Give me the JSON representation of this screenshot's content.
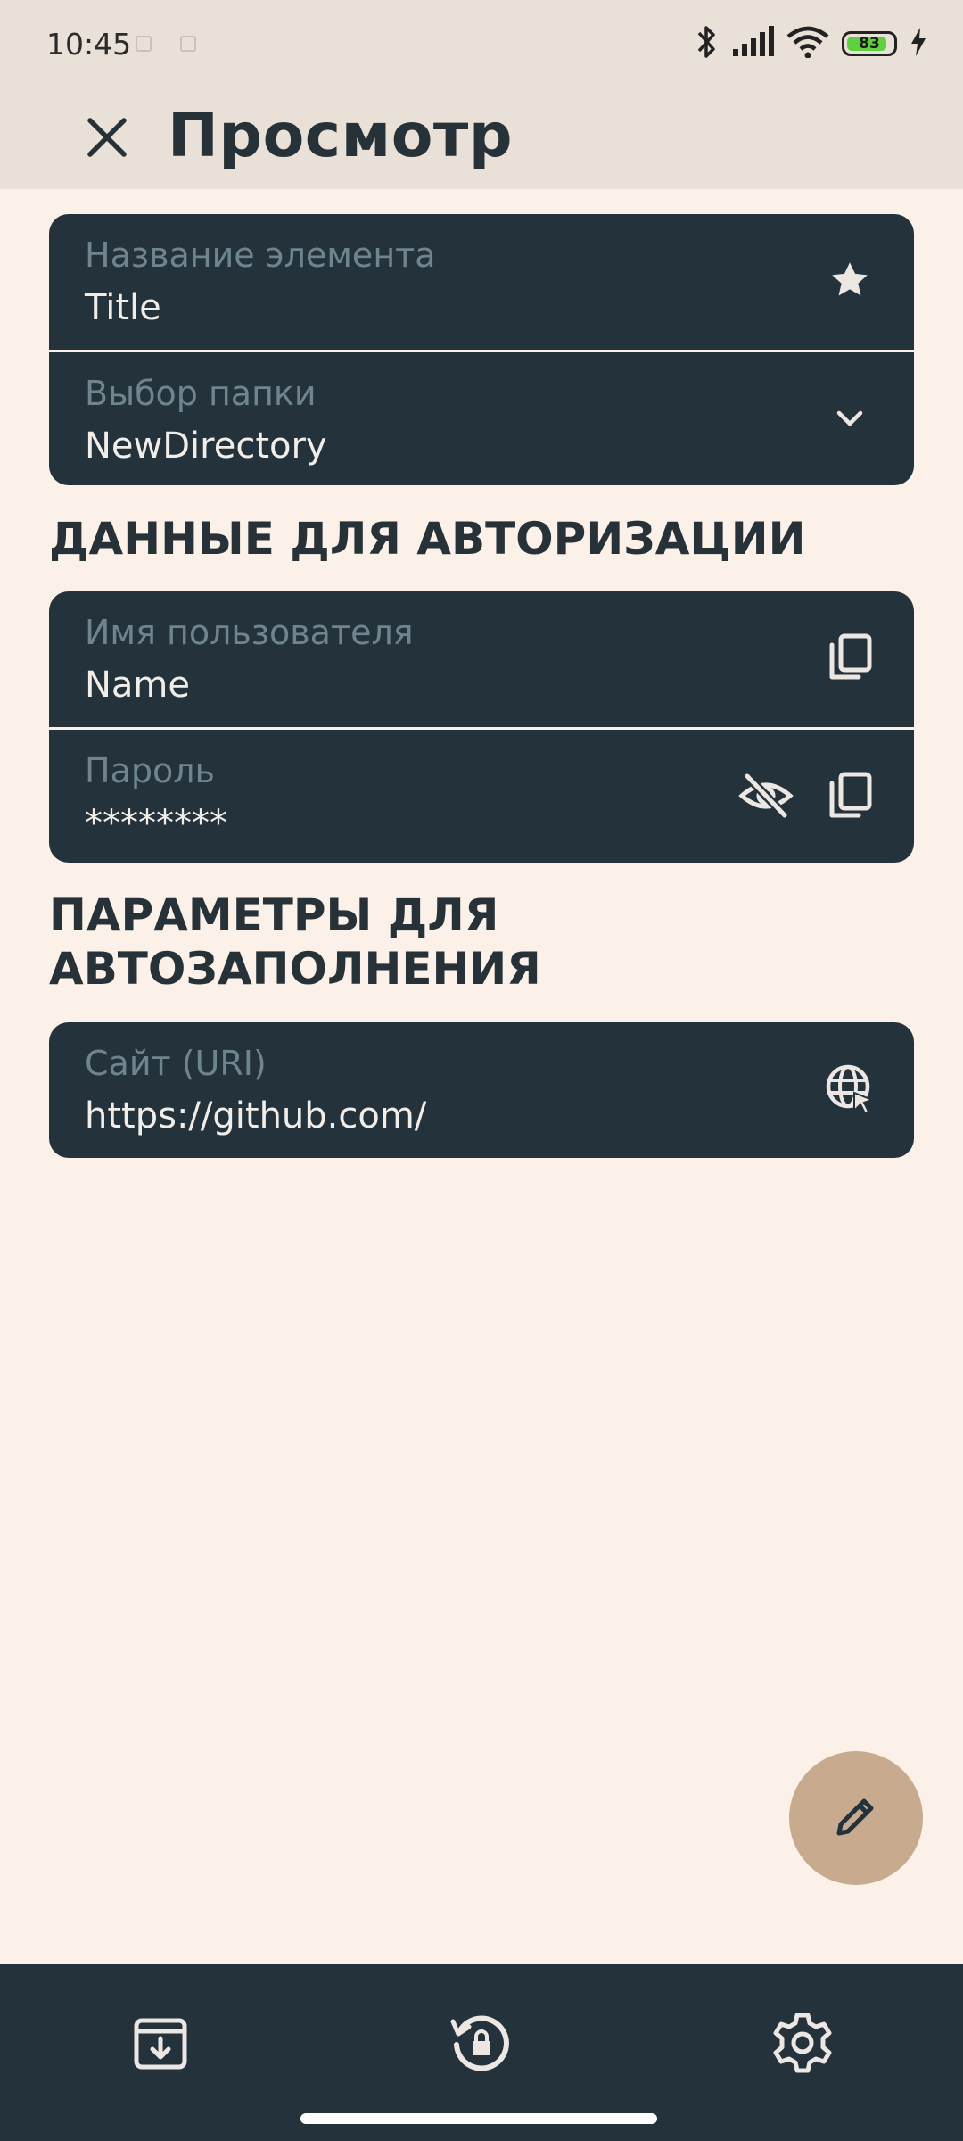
{
  "status_bar": {
    "time": "10:45",
    "battery_level": "83",
    "battery_fraction": 0.83,
    "icons": [
      "bluetooth-icon",
      "signal-icon",
      "wifi-icon",
      "battery-icon",
      "charging-icon"
    ]
  },
  "app_bar": {
    "title": "Просмотр",
    "close_icon": "close-icon"
  },
  "item_card": {
    "title_label": "Название элемента",
    "title_value": "Title",
    "favorite_icon": "star-icon",
    "folder_label": "Выбор папки",
    "folder_value": "NewDirectory",
    "folder_icon": "chevron-down-icon"
  },
  "auth_section": {
    "heading": "ДАННЫЕ ДЛЯ АВТОРИЗАЦИИ",
    "username_label": "Имя пользователя",
    "username_value": "Name",
    "password_label": "Пароль",
    "password_value": "********"
  },
  "autofill_section": {
    "heading_line1": "ПАРАМЕТРЫ ДЛЯ",
    "heading_line2": "АВТОЗАПОЛНЕНИЯ",
    "uri_label": "Сайт (URI)",
    "uri_value": "https://github.com/"
  },
  "fab": {
    "icon": "edit-icon"
  },
  "bottom_nav": {
    "items": [
      "import-icon",
      "lock-history-icon",
      "gear-icon"
    ]
  },
  "colors": {
    "background": "#fcf1e8",
    "app_bar": "#e9e0d7",
    "card": "#24323b",
    "label": "#6e8590",
    "value": "#f1ede9",
    "fab": "#c8ab8f"
  }
}
